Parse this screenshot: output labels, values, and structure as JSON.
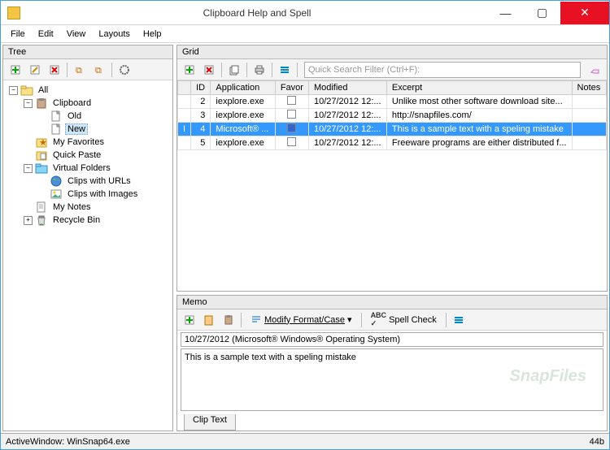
{
  "window": {
    "title": "Clipboard Help and Spell"
  },
  "menubar": [
    "File",
    "Edit",
    "View",
    "Layouts",
    "Help"
  ],
  "tree": {
    "header": "Tree",
    "nodes": [
      {
        "indent": 0,
        "toggle": "-",
        "icon": "folder",
        "label": "All",
        "selected": false
      },
      {
        "indent": 1,
        "toggle": "-",
        "icon": "clipboard",
        "label": "Clipboard",
        "selected": false
      },
      {
        "indent": 2,
        "toggle": "",
        "icon": "doc",
        "label": "Old",
        "selected": false
      },
      {
        "indent": 2,
        "toggle": "",
        "icon": "doc",
        "label": "New",
        "selected": true
      },
      {
        "indent": 1,
        "toggle": "",
        "icon": "star",
        "label": "My Favorites",
        "selected": false
      },
      {
        "indent": 1,
        "toggle": "",
        "icon": "paste",
        "label": "Quick Paste",
        "selected": false
      },
      {
        "indent": 1,
        "toggle": "-",
        "icon": "vfolder",
        "label": "Virtual Folders",
        "selected": false
      },
      {
        "indent": 2,
        "toggle": "",
        "icon": "globe",
        "label": "Clips with URLs",
        "selected": false
      },
      {
        "indent": 2,
        "toggle": "",
        "icon": "image",
        "label": "Clips with Images",
        "selected": false
      },
      {
        "indent": 1,
        "toggle": "",
        "icon": "note",
        "label": "My Notes",
        "selected": false
      },
      {
        "indent": 1,
        "toggle": "+",
        "icon": "trash",
        "label": "Recycle Bin",
        "selected": false
      }
    ]
  },
  "grid": {
    "header": "Grid",
    "search_placeholder": "Quick Search Filter (Ctrl+F):",
    "columns": [
      "",
      "ID",
      "Application",
      "Favor",
      "Modified",
      "Excerpt",
      "Notes"
    ],
    "rows": [
      {
        "id": "2",
        "app": "iexplore.exe",
        "fav": false,
        "modified": "10/27/2012 12:...",
        "excerpt": "Unlike most other software download site...",
        "notes": "",
        "selected": false
      },
      {
        "id": "3",
        "app": "iexplore.exe",
        "fav": false,
        "modified": "10/27/2012 12:...",
        "excerpt": "http://snapfiles.com/",
        "notes": "",
        "selected": false
      },
      {
        "id": "4",
        "app": "Microsoft® ...",
        "fav": true,
        "modified": "10/27/2012 12:...",
        "excerpt": "This is a sample text with a speling mistake",
        "notes": "",
        "selected": true
      },
      {
        "id": "5",
        "app": "iexplore.exe",
        "fav": false,
        "modified": "10/27/2012 12:...",
        "excerpt": "Freeware programs are either distributed f...",
        "notes": "",
        "selected": false
      }
    ]
  },
  "memo": {
    "header": "Memo",
    "modify_label": "Modify Format/Case",
    "spell_label": "Spell Check",
    "title_value": "10/27/2012 (Microsoft® Windows® Operating System)",
    "body_before": "This is a sample text with a ",
    "body_error": "speling",
    "body_after": " mistake",
    "tab": "Clip Text",
    "watermark": "SnapFiles"
  },
  "statusbar": {
    "left": "ActiveWindow: WinSnap64.exe",
    "right": "44b"
  }
}
